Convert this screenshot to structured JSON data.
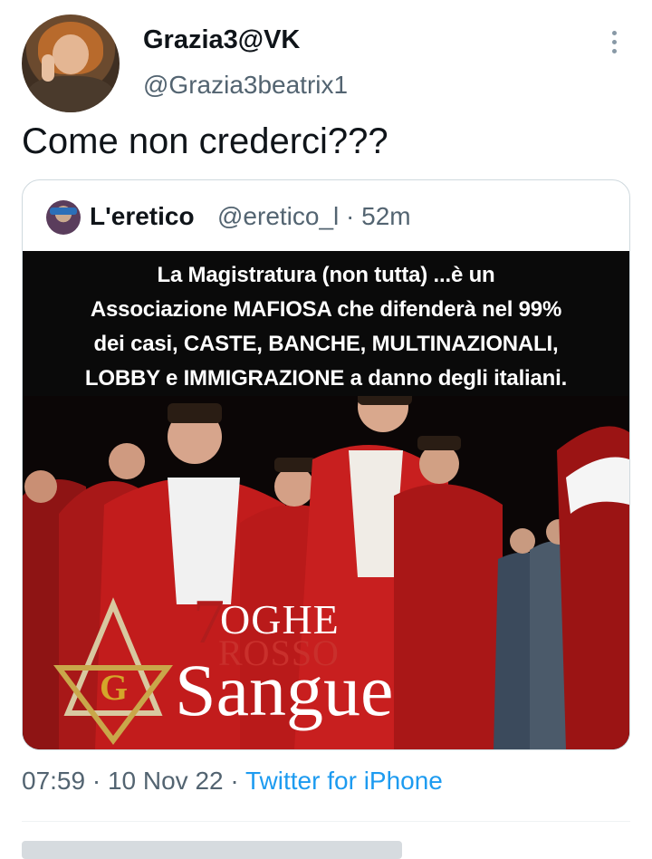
{
  "tweet": {
    "author": {
      "display_name": "Grazia3@VK",
      "handle": "@Grazia3beatrix1"
    },
    "text": "Come non crederci???",
    "quoted": {
      "display_name": "L'eretico",
      "handle": "@eretico_l",
      "time_ago": "52m",
      "image_caption_lines": [
        "La Magistratura (non tutta) ...è un",
        "Associazione MAFIOSA che difenderà nel 99%",
        "dei casi, CASTE,  BANCHE,  MULTINAZIONALI,",
        "LOBBY e IMMIGRAZIONE a danno degli italiani."
      ],
      "image_logo": {
        "line1": "OGHE",
        "line2": "ROSSO",
        "line3": "Sangue"
      }
    },
    "footer": {
      "time": "07:59",
      "date": "10 Nov 22",
      "source": "Twitter for iPhone"
    }
  },
  "icons": {
    "more": "vertical-dots-icon"
  }
}
